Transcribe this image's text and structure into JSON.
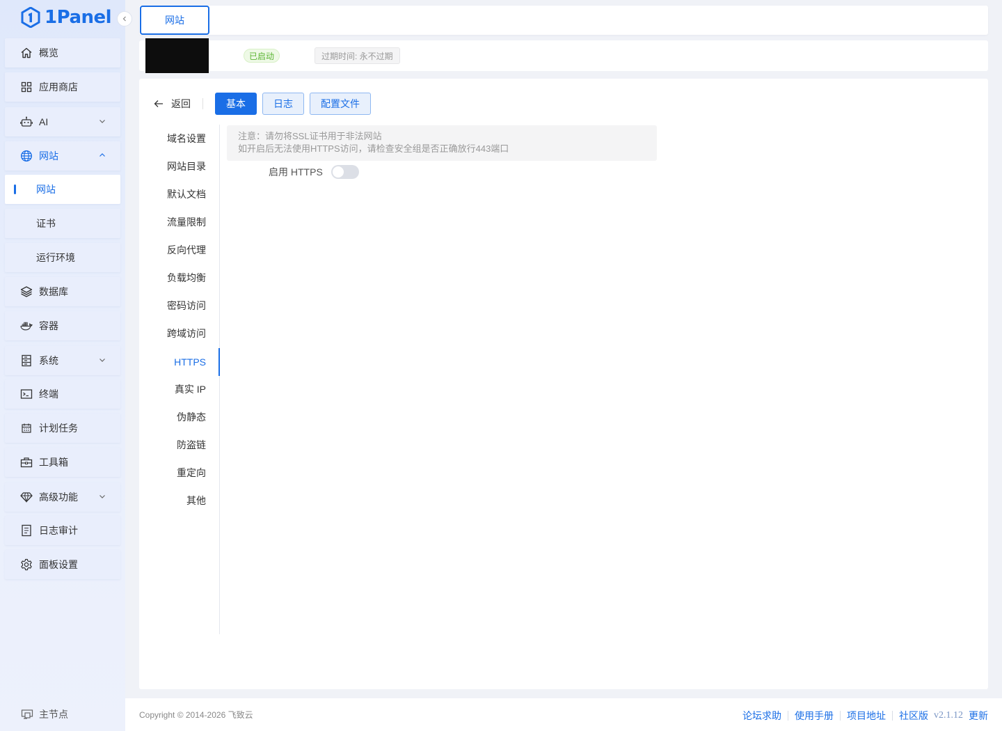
{
  "brand": {
    "name": "1Panel",
    "accent": "#1a6ee6"
  },
  "sidebar": {
    "items": [
      {
        "label": "概览",
        "icon": "home-icon"
      },
      {
        "label": "应用商店",
        "icon": "apps-grid-icon"
      },
      {
        "label": "AI",
        "icon": "robot-icon",
        "expandable": true
      },
      {
        "label": "网站",
        "icon": "globe-icon",
        "expanded": true
      },
      {
        "label": "网站",
        "sub": true,
        "active": true
      },
      {
        "label": "证书",
        "sub": true
      },
      {
        "label": "运行环境",
        "sub": true
      },
      {
        "label": "数据库",
        "icon": "layers-icon"
      },
      {
        "label": "容器",
        "icon": "docker-icon"
      },
      {
        "label": "系统",
        "icon": "server-icon",
        "expandable": true
      },
      {
        "label": "终端",
        "icon": "terminal-icon"
      },
      {
        "label": "计划任务",
        "icon": "calendar-icon"
      },
      {
        "label": "工具箱",
        "icon": "toolbox-icon"
      },
      {
        "label": "高级功能",
        "icon": "diamond-icon",
        "expandable": true
      },
      {
        "label": "日志审计",
        "icon": "log-icon"
      },
      {
        "label": "面板设置",
        "icon": "gear-icon"
      }
    ],
    "node_label": "主节点"
  },
  "tabs": {
    "active": "网站"
  },
  "site_info": {
    "status": "已启动",
    "expire": "过期时间: 永不过期"
  },
  "toolbar": {
    "back": "返回",
    "basic": "基本",
    "log": "日志",
    "config": "配置文件"
  },
  "menu": {
    "items": [
      "域名设置",
      "网站目录",
      "默认文档",
      "流量限制",
      "反向代理",
      "负载均衡",
      "密码访问",
      "跨域访问",
      "HTTPS",
      "真实 IP",
      "伪静态",
      "防盗链",
      "重定向",
      "其他"
    ],
    "active": "HTTPS"
  },
  "https": {
    "notice_line1": "注意：请勿将SSL证书用于非法网站",
    "notice_line2": "如开启后无法使用HTTPS访问，请检查安全组是否正确放行443端口",
    "enable_label": "启用 HTTPS",
    "enabled": false
  },
  "footer": {
    "copyright": "Copyright © 2014-2026 飞致云",
    "forum": "论坛求助",
    "manual": "使用手册",
    "project": "项目地址",
    "edition": "社区版",
    "version": "v2.1.12",
    "update": "更新"
  }
}
